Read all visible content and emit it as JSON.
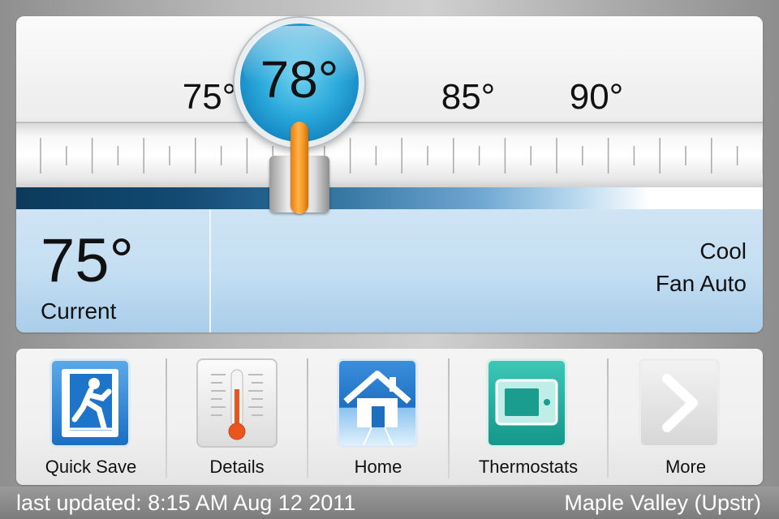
{
  "scale": {
    "labels": [
      "75°",
      "85°",
      "90°"
    ]
  },
  "setpoint": {
    "value": "78°",
    "handle_color": "#f39a26",
    "bubble_color": "#2aa9db"
  },
  "status": {
    "current_temp": "75°",
    "current_label": "Current",
    "mode": "Cool",
    "fan": "Fan Auto"
  },
  "nav": {
    "items": [
      {
        "label": "Quick Save",
        "icon": "exit-running-man-icon"
      },
      {
        "label": "Details",
        "icon": "thermometer-icon"
      },
      {
        "label": "Home",
        "icon": "house-icon"
      },
      {
        "label": "Thermostats",
        "icon": "thermostat-icon"
      },
      {
        "label": "More",
        "icon": "chevron-right-icon"
      }
    ]
  },
  "footer": {
    "last_updated": "last updated: 8:15 AM Aug 12 2011",
    "location": "Maple Valley (Upstr)"
  }
}
